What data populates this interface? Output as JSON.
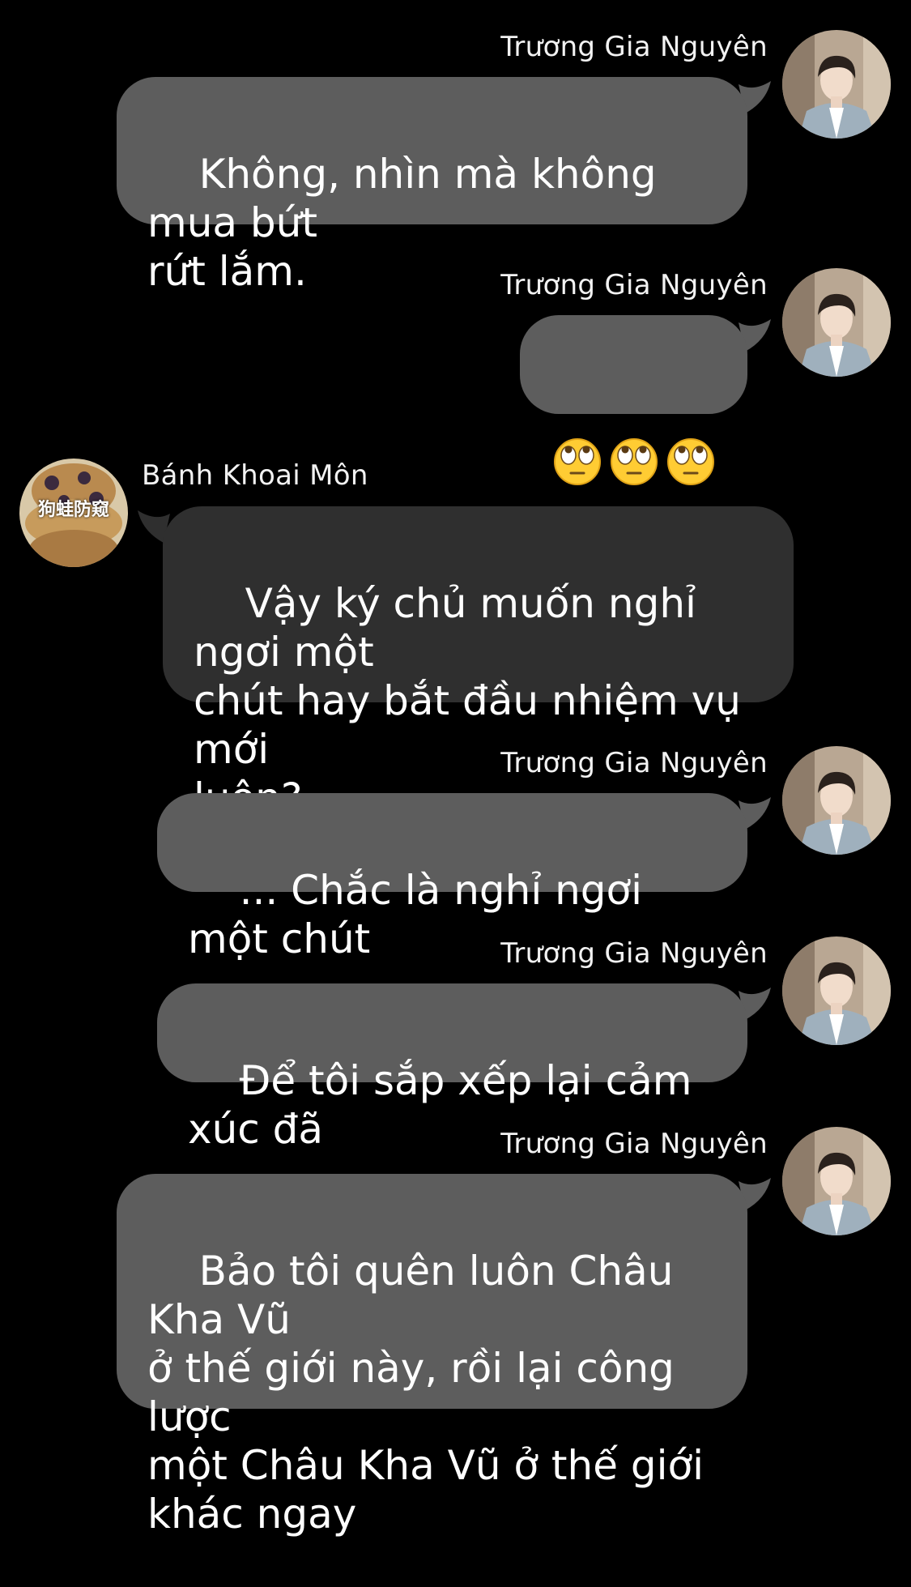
{
  "conversation": {
    "messages": [
      {
        "sender": "Trương Gia Nguyên",
        "text": "Không, nhìn mà không mua bứt\nrứt lắm."
      },
      {
        "sender": "Trương Gia Nguyên",
        "text": "",
        "emoji": [
          "rolling-eyes-icon",
          "rolling-eyes-icon",
          "rolling-eyes-icon"
        ]
      },
      {
        "sender": "Bánh Khoai Môn",
        "avatar_caption": "狗蛙防窥",
        "text": "Vậy ký chủ muốn nghỉ ngơi một\nchút hay bắt đầu nhiệm vụ mới\nluôn?"
      },
      {
        "sender": "Trương Gia Nguyên",
        "text": "... Chắc là nghỉ ngơi một chút"
      },
      {
        "sender": "Trương Gia Nguyên",
        "text": "Để tôi sắp xếp lại cảm xúc đã"
      },
      {
        "sender": "Trương Gia Nguyên",
        "text": "Bảo tôi quên luôn Châu Kha Vũ\nở thế giới này, rồi lại công lược\nmột Châu Kha Vũ ở thế giới\nkhác ngay"
      }
    ]
  },
  "colors": {
    "background": "#000000",
    "outgoing_bubble": "#5d5d5d",
    "incoming_bubble": "#2f2f2f",
    "text": "#ffffff"
  }
}
